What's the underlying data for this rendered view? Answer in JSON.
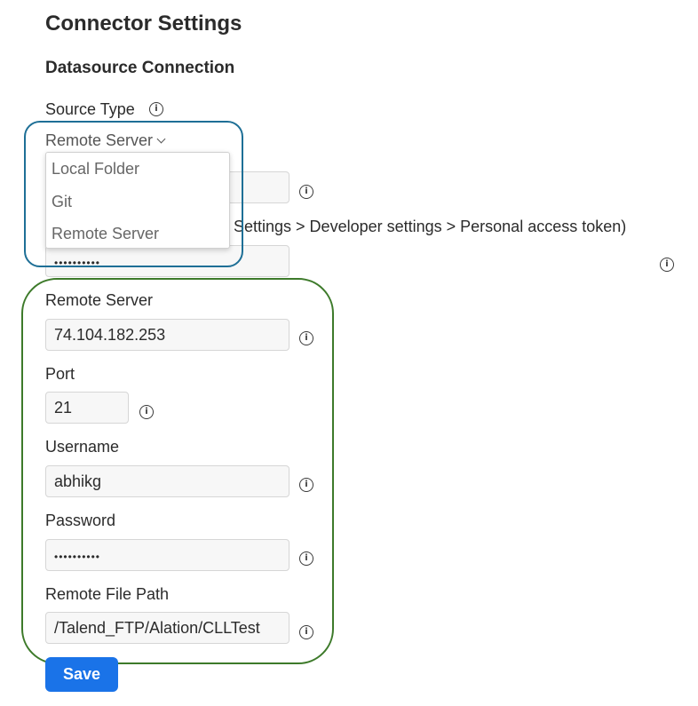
{
  "page": {
    "title": "Connector Settings",
    "section": "Datasource Connection"
  },
  "source_type": {
    "label": "Source Type",
    "selected": "Remote Server",
    "options": [
      "Local Folder",
      "Git",
      "Remote Server"
    ]
  },
  "git_hidden": {
    "token_hint_fragment": "Settings > Developer settings > Personal access token)",
    "token_mask": "••••••••••"
  },
  "fields": {
    "remote_server": {
      "label": "Remote Server",
      "value": "74.104.182.253"
    },
    "port": {
      "label": "Port",
      "value": "21"
    },
    "username": {
      "label": "Username",
      "value": "abhikg"
    },
    "password": {
      "label": "Password",
      "value": "••••••••••"
    },
    "remote_file_path": {
      "label": "Remote File Path",
      "value": "/Talend_FTP/Alation/CLLTest"
    }
  },
  "actions": {
    "save_label": "Save"
  },
  "icons": {
    "info": "info-icon",
    "chevron": "chevron-down-icon"
  },
  "colors": {
    "primary_button": "#1a73e8",
    "highlight_blue": "#1e6f96",
    "highlight_green": "#3d7a2a"
  }
}
